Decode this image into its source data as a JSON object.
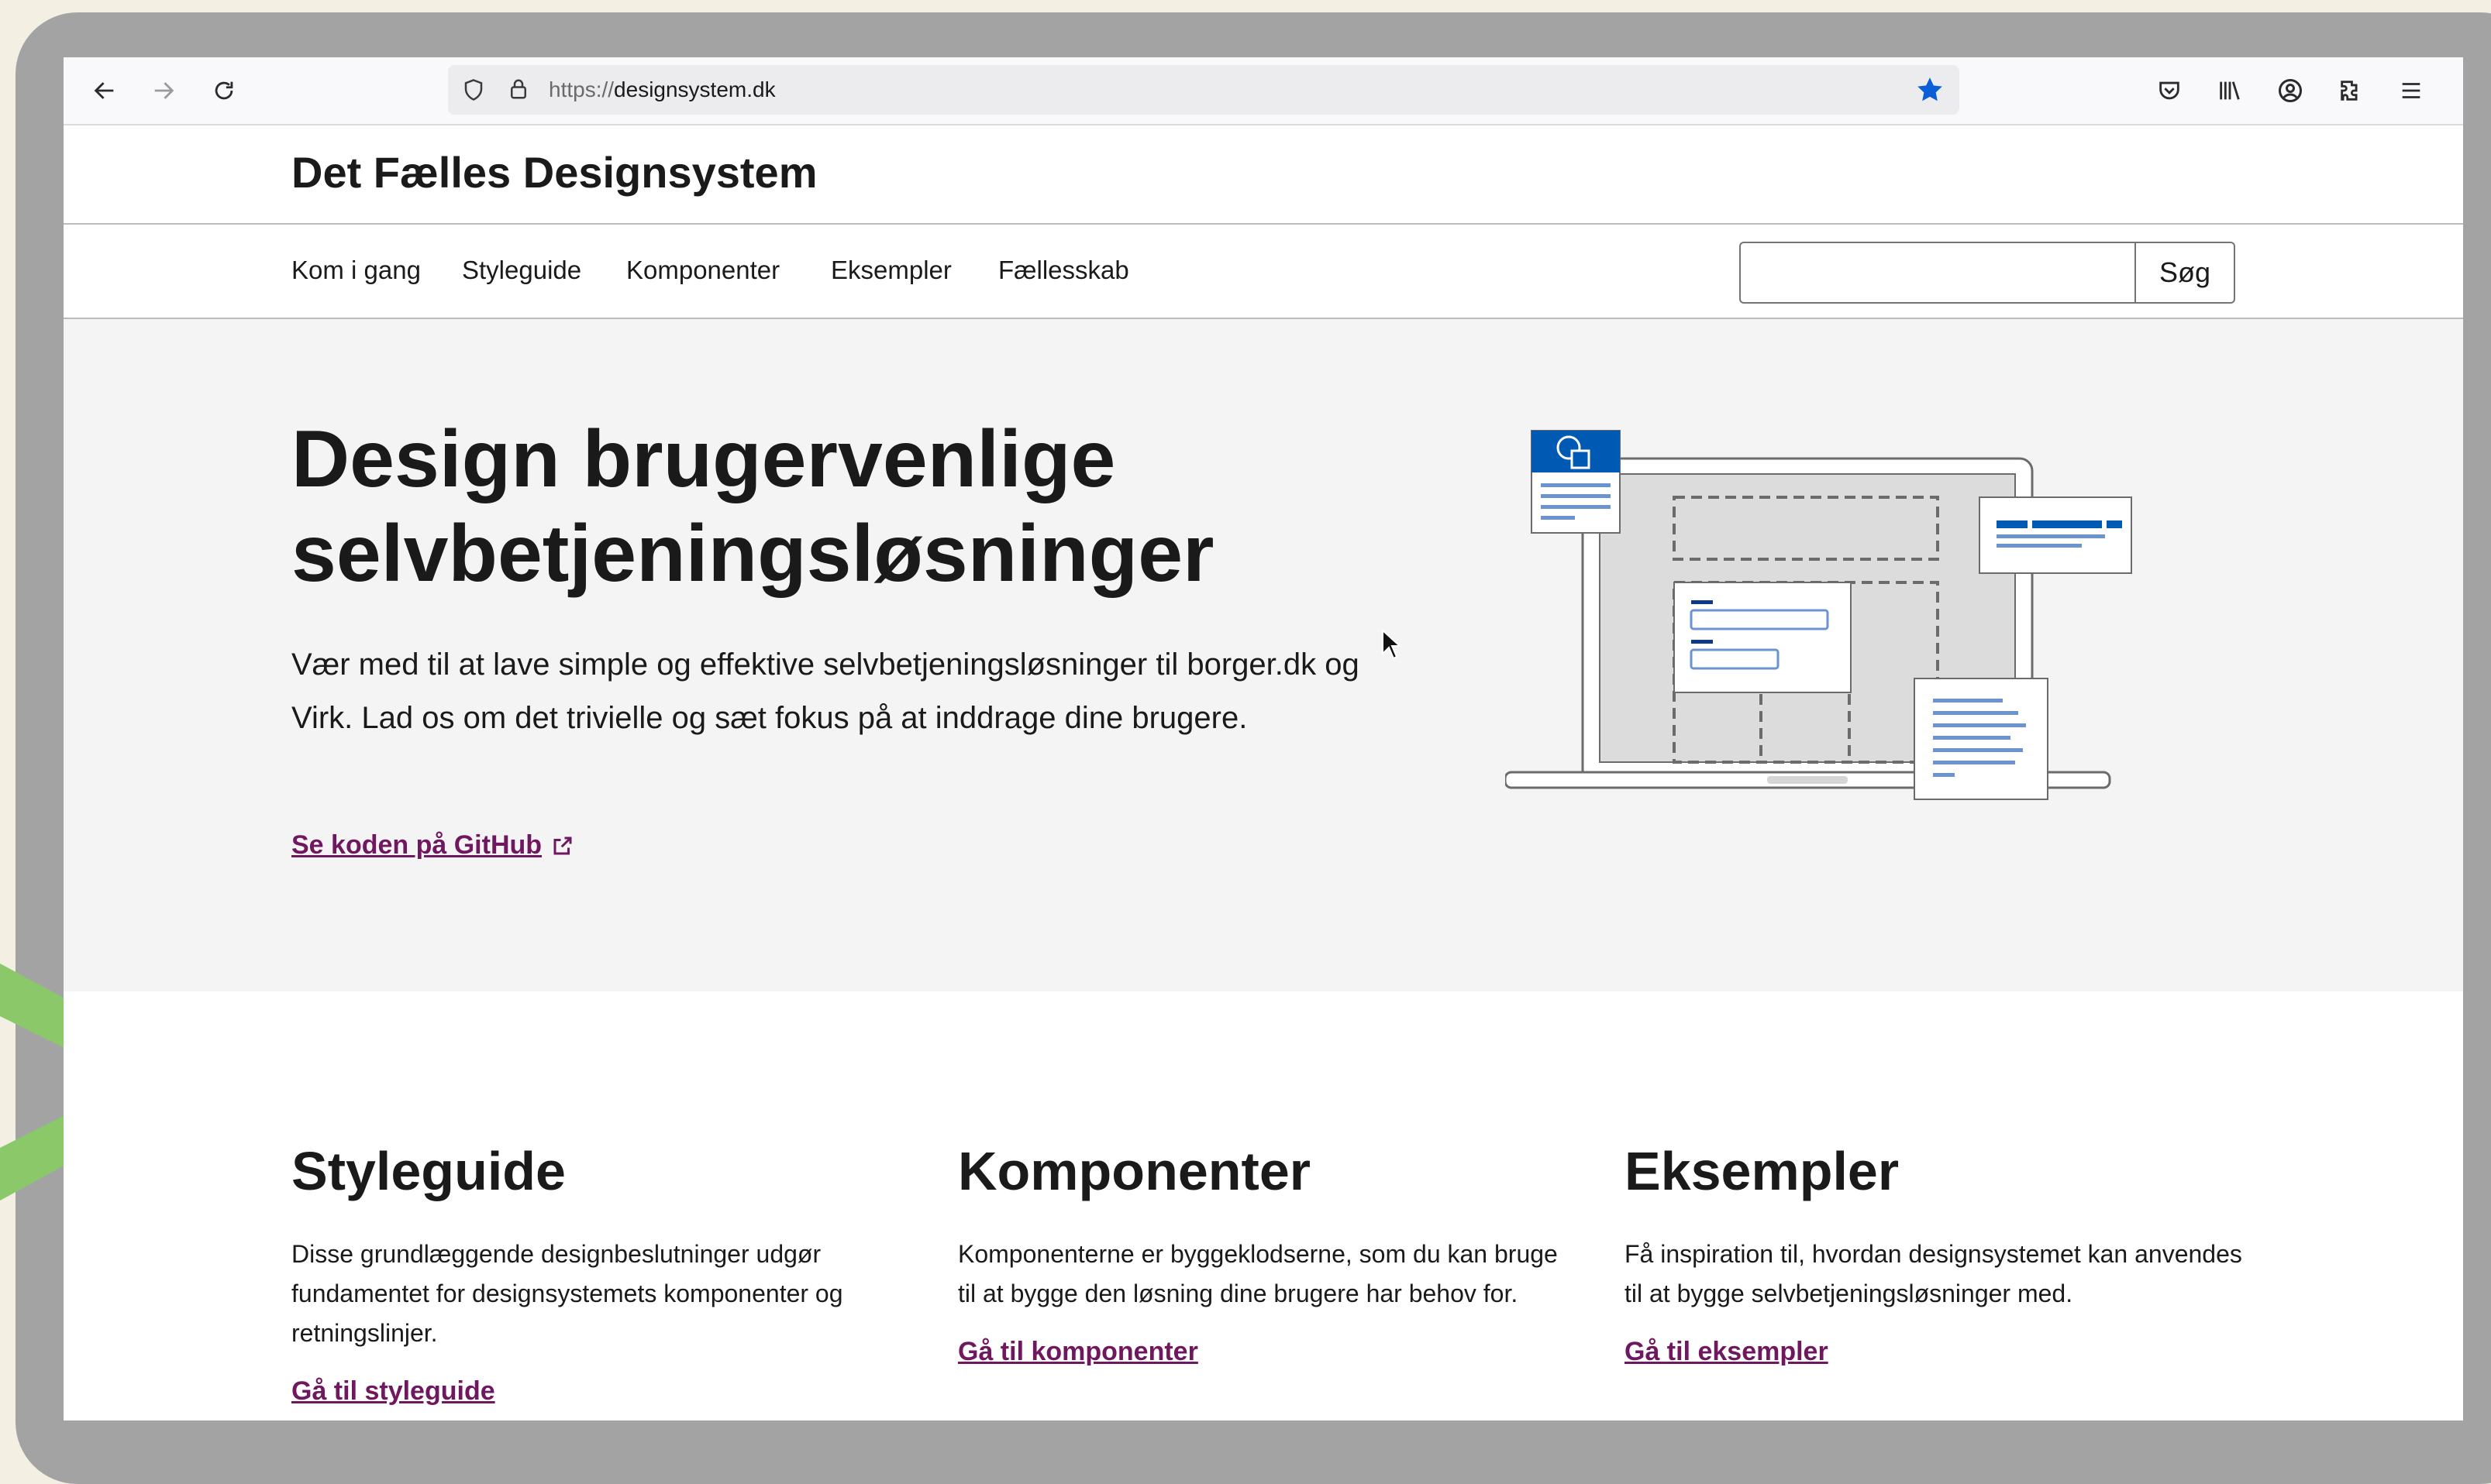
{
  "browser": {
    "url_protocol": "https://",
    "url_host": "designsystem.dk"
  },
  "site": {
    "title": "Det Fælles Designsystem",
    "nav": [
      "Kom i gang",
      "Styleguide",
      "Komponenter",
      "Eksempler",
      "Fællesskab"
    ],
    "search": {
      "value": "",
      "button_label": "Søg"
    }
  },
  "hero": {
    "heading": "Design brugervenlige selvbetjeningsløsninger",
    "lead": "Vær med til at lave simple og effektive selvbetjeningsløsninger til borger.dk og Virk. Lad os om det trivielle og sæt fokus på at inddrage dine brugere.",
    "link_label": "Se koden på GitHub"
  },
  "cards": [
    {
      "title": "Styleguide",
      "text": "Disse grundlæggende designbeslutninger udgør fundamentet for designsystemets komponenter og retningslinjer.",
      "link": "Gå til styleguide"
    },
    {
      "title": "Komponenter",
      "text": "Komponenterne er byggeklodserne, som du kan bruge til at bygge den løsning dine brugere har behov for.",
      "link": "Gå til komponenter"
    },
    {
      "title": "Eksempler",
      "text": "Få inspiration til, hvordan designsystemet kan anvendes til at bygge selvbetjeningsløsninger med.",
      "link": "Gå til eksempler"
    }
  ],
  "colors": {
    "link": "#70185f",
    "accent_blue": "#0059b3",
    "deco_green": "#8ac86a",
    "hero_bg": "#f4f4f4"
  }
}
